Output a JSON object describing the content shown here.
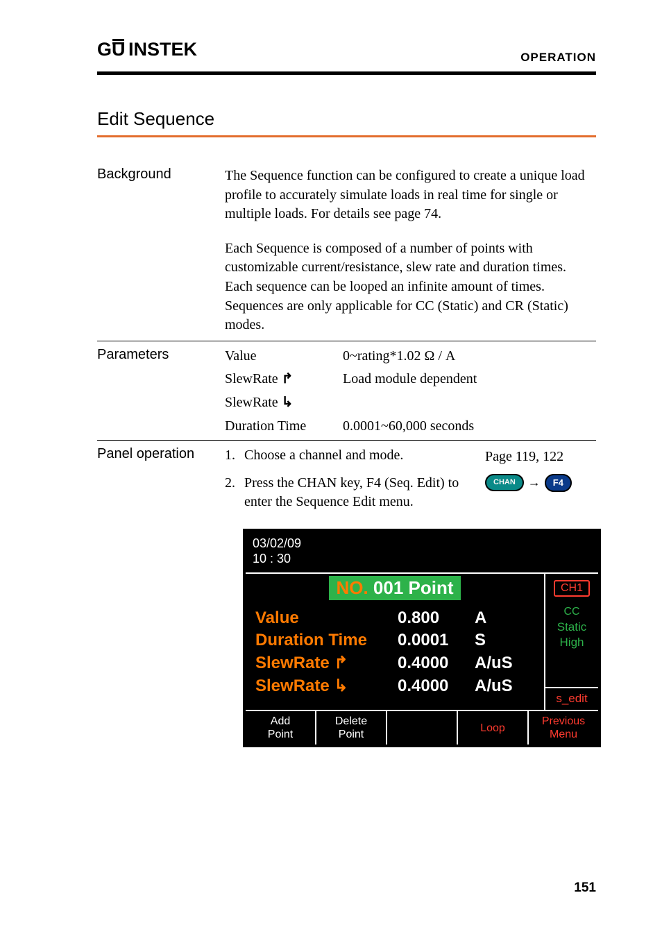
{
  "header": {
    "logo": "G␣INSTEK",
    "label": "OPERATION"
  },
  "section": {
    "title": "Edit Sequence"
  },
  "background": {
    "label": "Background",
    "para1": "The Sequence function can be configured to create a unique load profile to accurately simulate loads in real time for single or multiple loads. For details see page 74.",
    "para2": "Each Sequence is composed of a number of points with customizable current/resistance, slew rate and duration times. Each sequence can be looped an infinite amount of times. Sequences are only applicable for CC (Static) and CR (Static) modes."
  },
  "parameters": {
    "label": "Parameters",
    "rows": [
      {
        "name": "Value",
        "value": "0~rating*1.02 Ω / A"
      },
      {
        "name": "SlewRate ⤴",
        "value": "Load module dependent"
      },
      {
        "name": "SlewRate ⤵",
        "value": ""
      },
      {
        "name": "Duration Time",
        "value": "0.0001~60,000 seconds"
      }
    ]
  },
  "panel": {
    "label": "Panel operation",
    "steps": [
      {
        "num": "1.",
        "text": "Choose a channel and mode.",
        "ref": "Page 119, 122"
      },
      {
        "num": "2.",
        "text": "Press the CHAN key, F4 (Seq. Edit) to enter the Sequence Edit menu.",
        "chan": "CHAN",
        "f4": "F4"
      }
    ]
  },
  "device": {
    "datetime_line1": "03/02/09",
    "datetime_line2": "10 : 30",
    "title_no": "NO.",
    "title_rest": " 001  Point",
    "ch": "CH1",
    "side": {
      "cc": "CC",
      "static": "Static",
      "high": "High",
      "sedit": "s_edit"
    },
    "rows": [
      {
        "label": "Value",
        "val": "0.800",
        "unit": "A"
      },
      {
        "label": "Duration Time",
        "val": "0.0001",
        "unit": "S"
      },
      {
        "label": "SlewRate ⤴",
        "val": "0.4000",
        "unit": "A/uS"
      },
      {
        "label": "SlewRate ⤵",
        "val": "0.4000",
        "unit": "A/uS"
      }
    ],
    "buttons": {
      "b1a": "Add",
      "b1b": "Point",
      "b2a": "Delete",
      "b2b": "Point",
      "b4": "Loop",
      "b5a": "Previous",
      "b5b": "Menu"
    }
  },
  "pagenum": "151"
}
